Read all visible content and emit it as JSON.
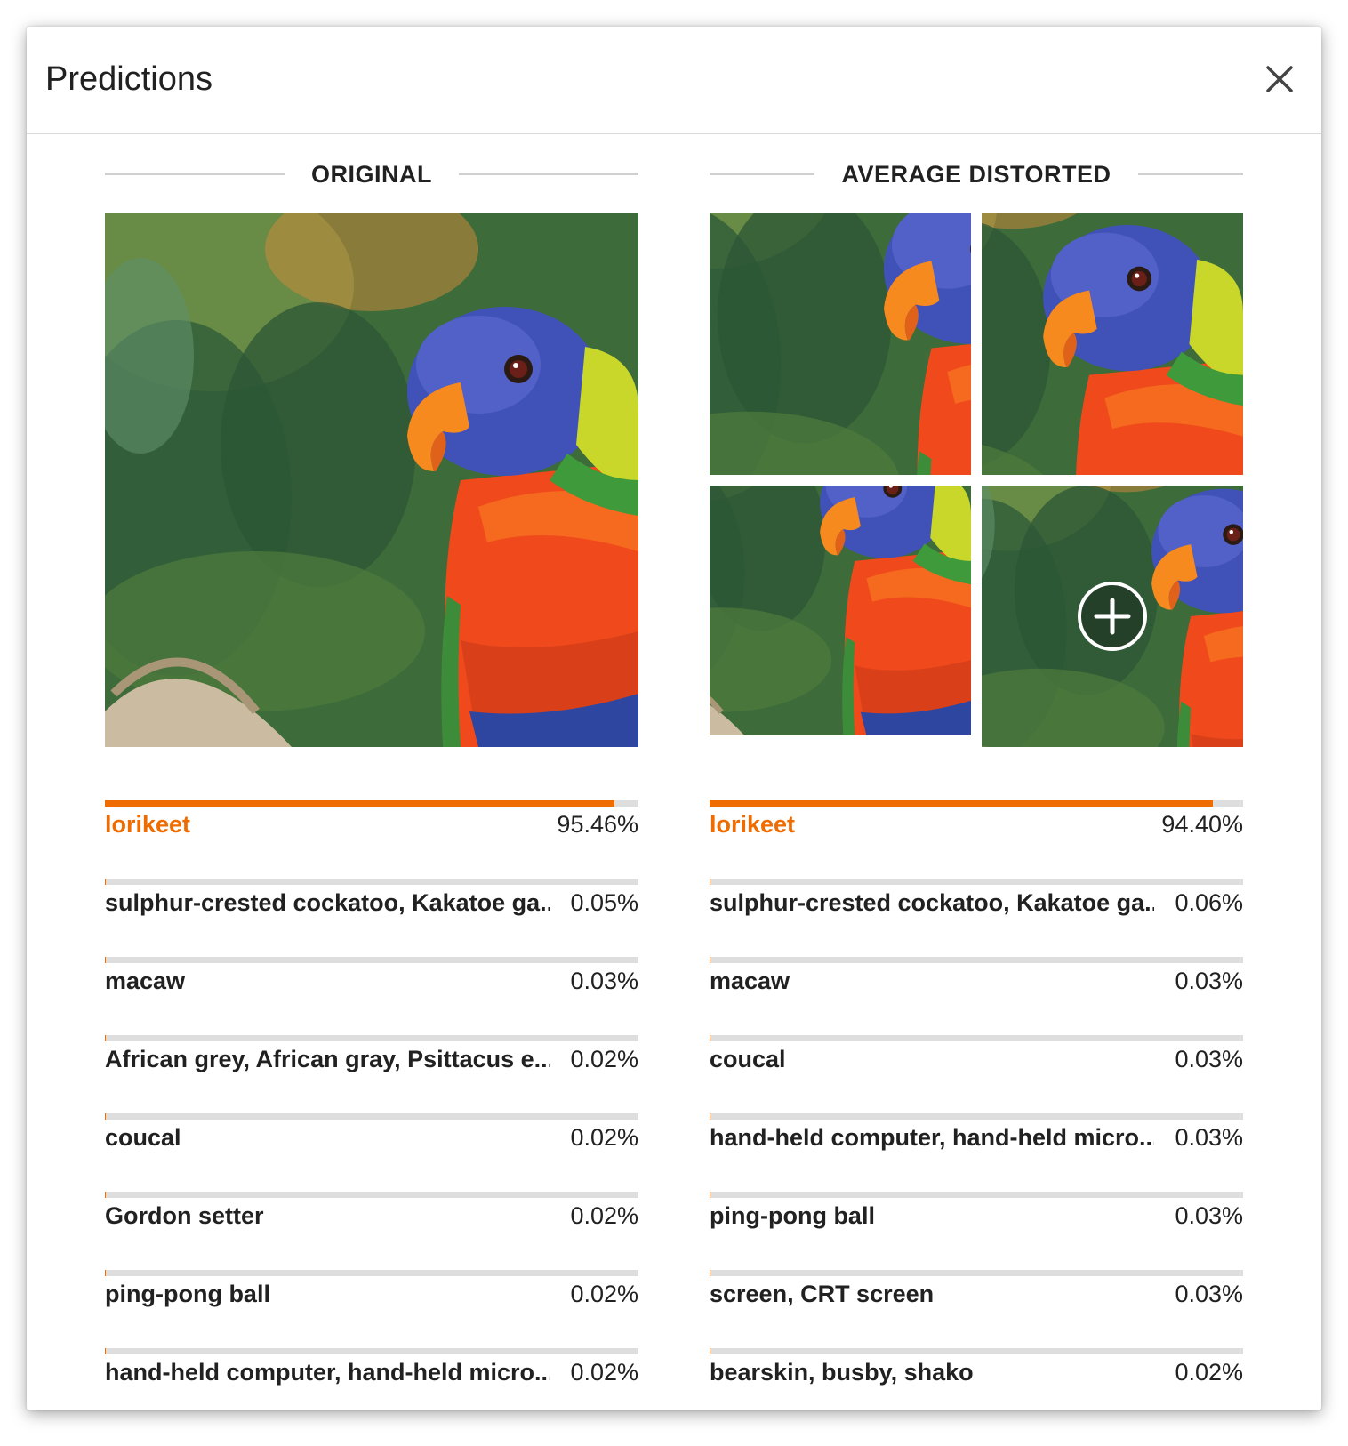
{
  "dialog": {
    "title": "Predictions",
    "close_icon": "close-icon"
  },
  "original": {
    "heading": "ORIGINAL",
    "predictions": [
      {
        "label": "lorikeet",
        "percent_text": "95.46%",
        "value": 0.9546
      },
      {
        "label": "sulphur-crested cockatoo, Kakatoe ga...",
        "percent_text": "0.05%",
        "value": 0.0005
      },
      {
        "label": "macaw",
        "percent_text": "0.03%",
        "value": 0.0003
      },
      {
        "label": "African grey, African gray, Psittacus e...",
        "percent_text": "0.02%",
        "value": 0.0002
      },
      {
        "label": "coucal",
        "percent_text": "0.02%",
        "value": 0.0002
      },
      {
        "label": "Gordon setter",
        "percent_text": "0.02%",
        "value": 0.0002
      },
      {
        "label": "ping-pong ball",
        "percent_text": "0.02%",
        "value": 0.0002
      },
      {
        "label": "hand-held computer, hand-held micro...",
        "percent_text": "0.02%",
        "value": 0.0002
      }
    ]
  },
  "distorted": {
    "heading": "AVERAGE DISTORTED",
    "add_icon": "plus-circle-icon",
    "predictions": [
      {
        "label": "lorikeet",
        "percent_text": "94.40%",
        "value": 0.944
      },
      {
        "label": "sulphur-crested cockatoo, Kakatoe ga...",
        "percent_text": "0.06%",
        "value": 0.0006
      },
      {
        "label": "macaw",
        "percent_text": "0.03%",
        "value": 0.0003
      },
      {
        "label": "coucal",
        "percent_text": "0.03%",
        "value": 0.0003
      },
      {
        "label": "hand-held computer, hand-held micro...",
        "percent_text": "0.03%",
        "value": 0.0003
      },
      {
        "label": "ping-pong ball",
        "percent_text": "0.03%",
        "value": 0.0003
      },
      {
        "label": "screen, CRT screen",
        "percent_text": "0.03%",
        "value": 0.0003
      },
      {
        "label": "bearskin, busby, shako",
        "percent_text": "0.02%",
        "value": 0.0002
      }
    ]
  },
  "colors": {
    "accent": "#ef6c00",
    "bar_track": "#dedede",
    "text": "#212121"
  }
}
